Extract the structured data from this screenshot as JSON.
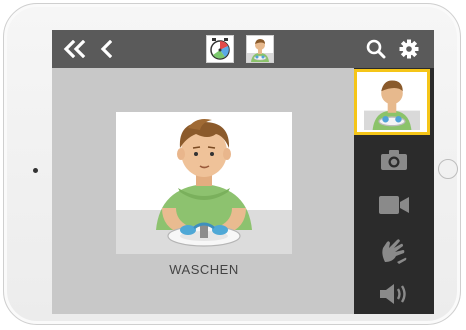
{
  "topbar": {
    "back_all_icon": "double-chevron-left-icon",
    "back_icon": "chevron-left-icon",
    "timer_icon": "timer-clock-icon",
    "current_activity_thumbnail": "washing-hands-thumbnail",
    "search_icon": "search-icon",
    "settings_icon": "gear-icon"
  },
  "main": {
    "card_label": "WASCHEN",
    "card_picture": "boy-washing-hands-picture"
  },
  "side_panel": {
    "items": [
      {
        "icon": "washing-hands-thumbnail",
        "selected": true
      },
      {
        "icon": "camera-icon",
        "selected": false
      },
      {
        "icon": "video-camera-icon",
        "selected": false
      },
      {
        "icon": "sign-language-hand-icon",
        "selected": false
      },
      {
        "icon": "speaker-icon",
        "selected": false
      }
    ]
  },
  "colors": {
    "topbar_bg": "#5a5a5a",
    "screen_bg": "#c8c8c8",
    "side_panel_bg": "#2b2b2b",
    "selected_border": "#f5c518",
    "icon_light": "#ffffff",
    "icon_dark": "#8a8a8a"
  }
}
